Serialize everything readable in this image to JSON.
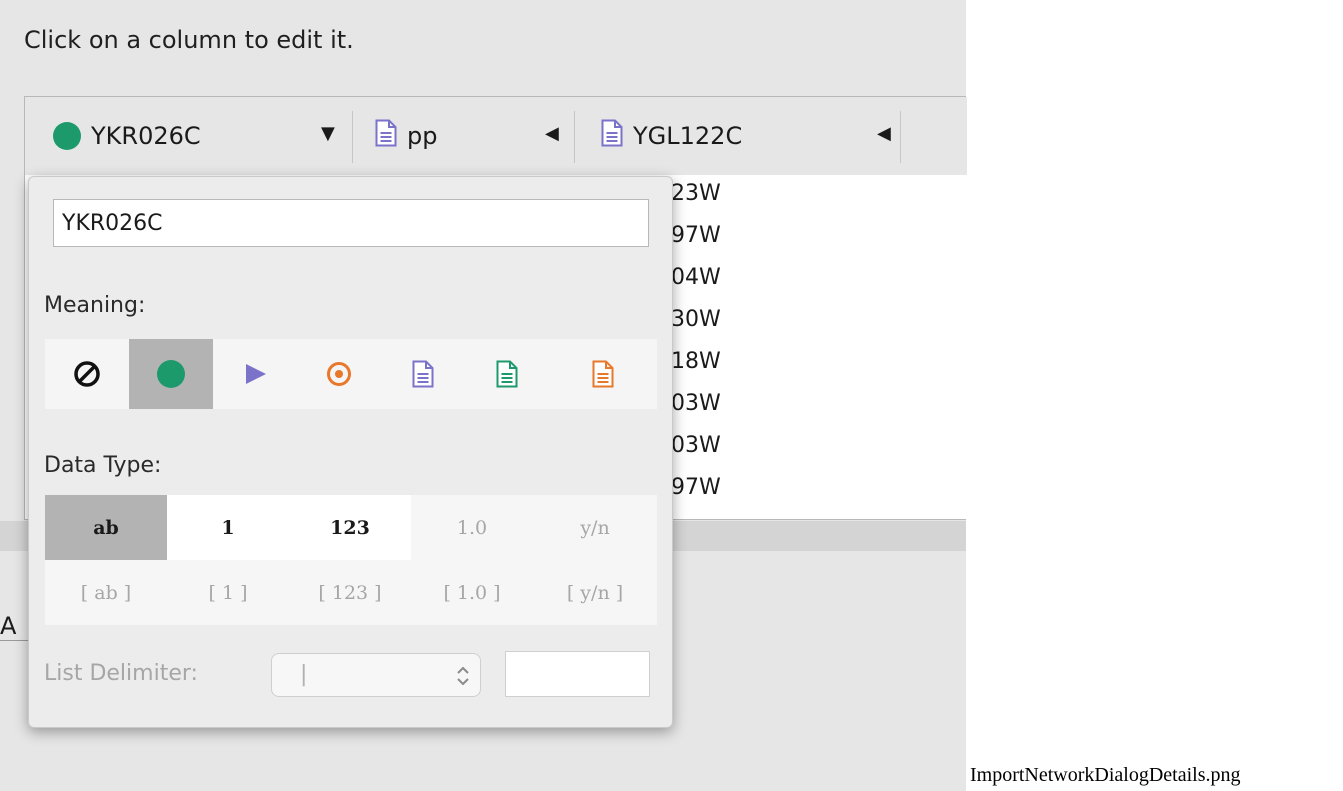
{
  "instruction": "Click on a column to edit it.",
  "columns": [
    {
      "label": "YKR026C",
      "meaning_icon": "source-node-icon",
      "arrow": "▼"
    },
    {
      "label": "pp",
      "meaning_icon": "edge-attribute-icon",
      "arrow": "◀"
    },
    {
      "label": "YGL122C",
      "meaning_icon": "edge-attribute-icon",
      "arrow": "◀"
    }
  ],
  "visible_cells": [
    "23W",
    "97W",
    "04W",
    "30W",
    "18W",
    "03W",
    "03W",
    "97W"
  ],
  "stray_text": "A",
  "editor": {
    "name_value": "YKR026C",
    "meaning_label": "Meaning:",
    "meaning_options": [
      {
        "icon": "no-import-icon",
        "selected": false
      },
      {
        "icon": "source-node-icon",
        "selected": true
      },
      {
        "icon": "interaction-type-icon",
        "selected": false
      },
      {
        "icon": "target-node-icon",
        "selected": false
      },
      {
        "icon": "edge-attribute-icon",
        "selected": false
      },
      {
        "icon": "source-node-attribute-icon",
        "selected": false
      },
      {
        "icon": "target-node-attribute-icon",
        "selected": false
      }
    ],
    "data_type_label": "Data Type:",
    "data_types_row1": [
      "ab",
      "1",
      "123",
      "1.0",
      "y/n"
    ],
    "data_types_row2": [
      "[ ab ]",
      "[ 1 ]",
      "[ 123 ]",
      "[ 1.0 ]",
      "[ y/n ]"
    ],
    "selected_data_type": "ab",
    "list_delimiter_label": "List Delimiter:",
    "list_delimiter_value": "|",
    "list_delimiter_other": ""
  },
  "caption": "ImportNetworkDialogDetails.png",
  "colors": {
    "source_node": "#1d9a6c",
    "interaction": "#7b73c9",
    "target_node": "#e8782a",
    "edge_attr": "#7b73c9",
    "source_attr": "#1d9a6c",
    "target_attr": "#e8782a",
    "selected_bg": "#b3b3b3"
  }
}
